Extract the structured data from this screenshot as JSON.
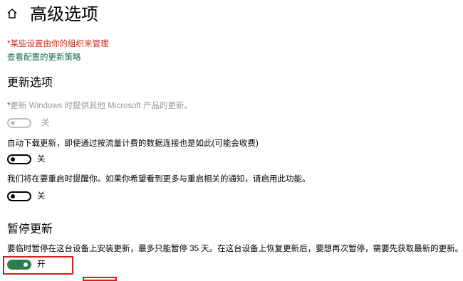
{
  "header": {
    "title": "高级选项",
    "home_icon": "home-icon"
  },
  "notice": {
    "managed_text": "*某些设置由你的组织来管理",
    "policy_link": "查看配置的更新策略"
  },
  "update_options": {
    "heading": "更新选项",
    "items": [
      {
        "star": "*",
        "description": "更新 Windows 时提供其他 Microsoft 产品的更新。",
        "state_label": "关",
        "disabled": true
      },
      {
        "description": "自动下载更新，即使通过按流量计费的数据连接也是如此(可能会收费)",
        "state_label": "关",
        "disabled": false
      },
      {
        "description": "我们将在要重启时提醒你。如果你希望看到更多与重启相关的通知，请启用此功能。",
        "state_label": "关",
        "disabled": false
      }
    ]
  },
  "pause_updates": {
    "heading": "暂停更新",
    "description": "要临时暂停在这台设备上安装更新，最多只能暂停 35 天。在这台设备上恢复更新后，要想再次暂停，需要先获取最新的更新。",
    "state_label": "开",
    "on": true
  },
  "colors": {
    "warning_red": "#c42b1c",
    "link_green": "#0f6b3f",
    "toggle_on_green": "#2e7d4f",
    "highlight_red": "#d42020"
  }
}
